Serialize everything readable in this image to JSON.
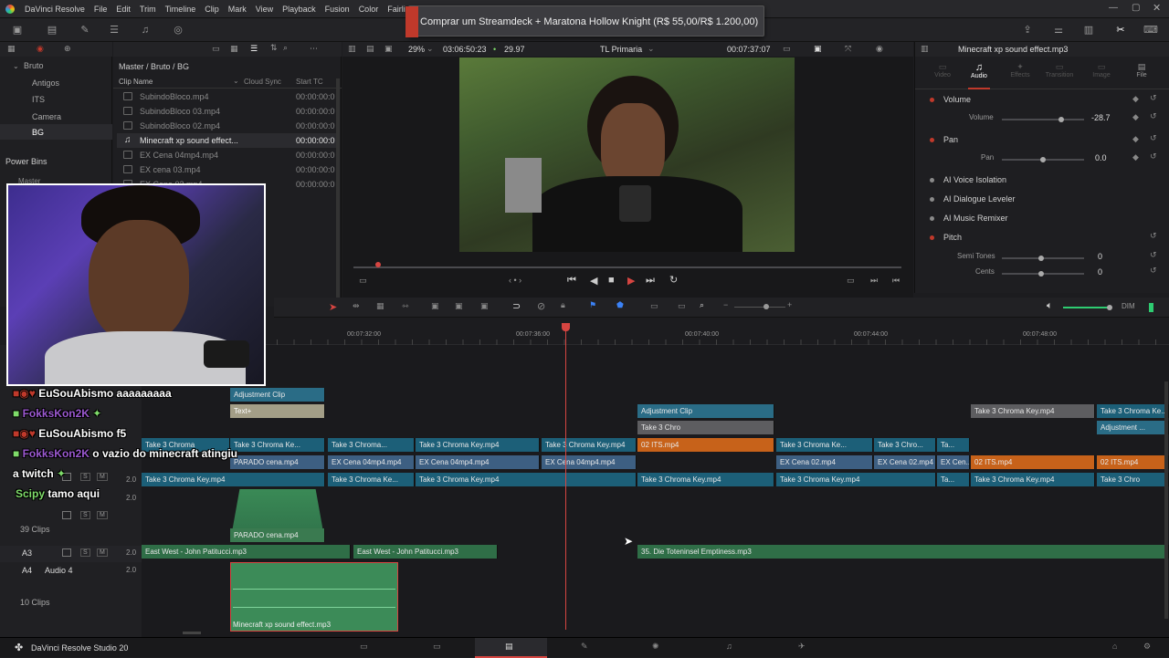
{
  "menu": [
    "DaVinci Resolve",
    "File",
    "Edit",
    "Trim",
    "Timeline",
    "Clip",
    "Mark",
    "View",
    "Playback",
    "Fusion",
    "Color",
    "Fairlig"
  ],
  "banner": {
    "text": "Comprar um Streamdeck + Maratona Hollow Knight (R$ 55,00/R$ 1.200,00)"
  },
  "bins": {
    "items": [
      "Bruto",
      "Antigos",
      "ITS",
      "Camera",
      "BG"
    ],
    "power_bins": "Power Bins",
    "master": "Master"
  },
  "media": {
    "breadcrumb": "Master / Bruto / BG",
    "col_name": "Clip Name",
    "col_cloud": "Cloud Sync",
    "col_tc": "Start TC",
    "clips": [
      {
        "name": "SubindoBloco.mp4",
        "tc": "00:00:00:0"
      },
      {
        "name": "SubindoBloco 03.mp4",
        "tc": "00:00:00:0"
      },
      {
        "name": "SubindoBloco 02.mp4",
        "tc": "00:00:00:0"
      },
      {
        "name": "Minecraft xp sound effect...",
        "tc": "00:00:00:0"
      },
      {
        "name": "EX Cena 04mp4.mp4",
        "tc": "00:00:00:0"
      },
      {
        "name": "EX cena 03.mp4",
        "tc": "00:00:00:0"
      },
      {
        "name": "EX Cena 02.mp4",
        "tc": "00:00:00:0"
      }
    ]
  },
  "viewer": {
    "zoom": "29%",
    "timecode": "03:06:50:23",
    "fps": "29.97",
    "timeline_name": "TL Primaria",
    "current_tc": "00:07:37:07"
  },
  "inspector": {
    "title": "Minecraft xp sound effect.mp3",
    "tabs": [
      "Video",
      "Audio",
      "Effects",
      "Transition",
      "Image",
      "File"
    ],
    "volume_label": "Volume",
    "volume_sub": "Volume",
    "volume_val": "-28.7",
    "volume_frac": 0.72,
    "pan_label": "Pan",
    "pan_sub": "Pan",
    "pan_val": "0.0",
    "pan_frac": 0.5,
    "ai_voice": "AI Voice Isolation",
    "ai_dialogue": "AI Dialogue Leveler",
    "ai_music": "AI Music Remixer",
    "pitch_label": "Pitch",
    "semi_label": "Semi Tones",
    "semi_val": "0",
    "cents_label": "Cents",
    "cents_val": "0"
  },
  "ruler": [
    "00:07:32:00",
    "00:07:36:00",
    "00:07:40:00",
    "00:07:44:00",
    "00:07:48:00"
  ],
  "tracks": {
    "v1_count": "39 Clips",
    "a3": "A3",
    "a4": "A4",
    "a4_name": "Audio 4",
    "a4_count": "10 Clips",
    "level": "2.0"
  },
  "clips": {
    "adj1": "Adjustment Clip",
    "text1": "Text+",
    "adj2": "Adjustment Clip",
    "chroma": "Take 3 Chroma Key.mp4",
    "chroma_short": "Take 3 Chroma Ke...",
    "chroma_short2": "Take 3 Chroma...",
    "chroma_short3": "Take 3 Chroma",
    "chroma_short4": "Take 3 Chro...",
    "chroma_short5": "Ta...",
    "chroma_short6": "Take 3 Chro",
    "adjust_short": "Adjustment ...",
    "its": "02 ITS.mp4",
    "parado": "PARADO cena.mp4",
    "excena04": "EX Cena 04mp4.mp4",
    "excena02": "EX Cena 02.mp4",
    "excena_short": "EX Cen...",
    "ta": "Ta...",
    "eastwest": "East West - John Patitucci.mp3",
    "toteninsel": "35. Die Toteninsel Emptiness.mp3",
    "minecraft": "Minecraft xp sound effect.mp3"
  },
  "footer": {
    "app": "DaVinci Resolve Studio 20",
    "dim": "DIM"
  },
  "chat": [
    {
      "user": "EuSouAbismo",
      "msg": "aaaaaaaaa"
    },
    {
      "user": "FokksKon2K",
      "msg": ""
    },
    {
      "user": "EuSouAbismo",
      "msg": "f5"
    },
    {
      "user": "FokksKon2K",
      "msg": "o vazio do minecraft atingiu"
    },
    {
      "user": "",
      "msg": "a twitch"
    },
    {
      "user": "Scipy",
      "msg": "tamo aqui"
    }
  ]
}
